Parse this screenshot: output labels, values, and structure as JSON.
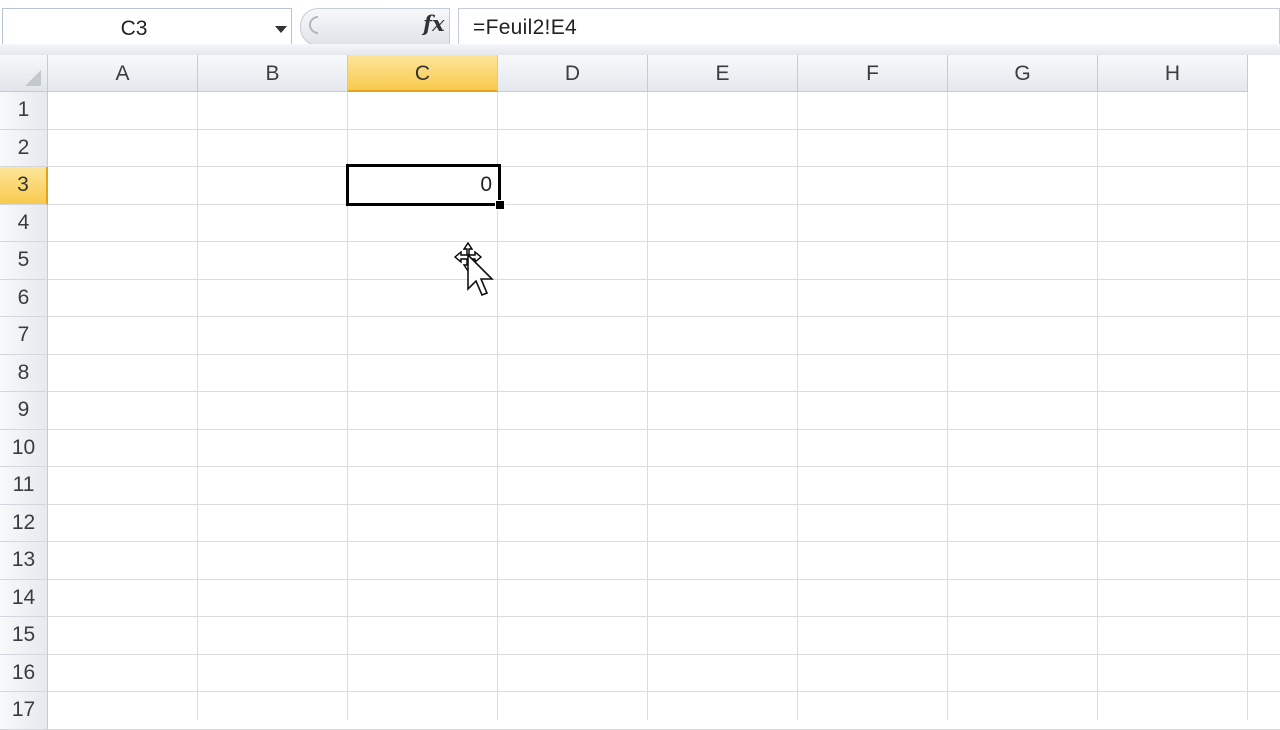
{
  "formula_bar": {
    "name_box": "C3",
    "fx_label": "fx",
    "formula": "=Feuil2!E4"
  },
  "sheet": {
    "columns": [
      "A",
      "B",
      "C",
      "D",
      "E",
      "F",
      "G",
      "H"
    ],
    "rows": [
      "1",
      "2",
      "3",
      "4",
      "5",
      "6",
      "7",
      "8",
      "9",
      "10",
      "11",
      "12",
      "13",
      "14",
      "15",
      "16",
      "17"
    ],
    "active_column": "C",
    "active_row": "3",
    "active_cell_value": "0"
  },
  "colors": {
    "header_highlight": "#f8c94d",
    "gridline": "#dadcdd",
    "selection_border": "#000000"
  }
}
